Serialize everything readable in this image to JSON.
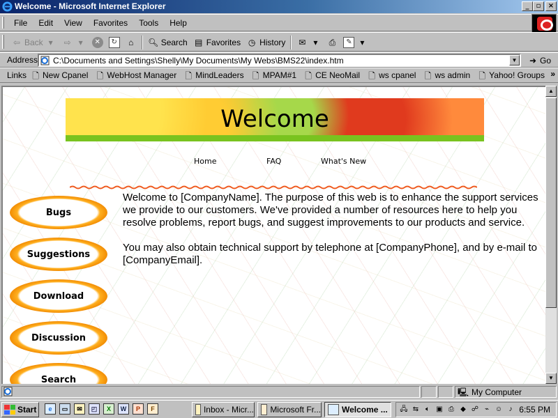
{
  "window": {
    "title": "Welcome - Microsoft Internet Explorer",
    "controls": {
      "minimize": "_",
      "maximize": "▫",
      "close": "×"
    }
  },
  "menu": [
    "File",
    "Edit",
    "View",
    "Favorites",
    "Tools",
    "Help"
  ],
  "toolbar": {
    "back": "Back",
    "search": "Search",
    "favorites": "Favorites",
    "history": "History"
  },
  "address": {
    "label": "Address",
    "value": "C:\\Documents and Settings\\Shelly\\My Documents\\My Webs\\BMS22\\index.htm",
    "go": "Go"
  },
  "links": {
    "label": "Links",
    "items": [
      "New Cpanel",
      "WebHost Manager",
      "MindLeaders",
      "MPAM#1",
      "CE NeoMail",
      "ws cpanel",
      "ws admin",
      "Yahoo! Groups"
    ],
    "more": "»"
  },
  "page": {
    "banner_title": "Welcome",
    "nav": [
      "Home",
      "FAQ",
      "What's New"
    ],
    "sidebar": [
      "Bugs",
      "Suggestions",
      "Download",
      "Discussion",
      "Search"
    ],
    "paragraphs": [
      "Welcome to [CompanyName]. The purpose of this web is to enhance the support services we provide to our customers. We've provided a number of resources here to help you resolve problems, report bugs, and suggest improvements to our products and service.",
      "You may also obtain technical support by telephone at [CompanyPhone], and by e-mail to [CompanyEmail]."
    ]
  },
  "status": {
    "zone": "My Computer"
  },
  "taskbar": {
    "start": "Start",
    "tasks": [
      "Inbox - Micr...",
      "Microsoft Fr...",
      "Welcome ..."
    ],
    "clock": "6:55 PM"
  },
  "colors": {
    "titlebar": "#0a246a",
    "banner_green": "#79c31f",
    "accent_orange": "#f08800"
  }
}
